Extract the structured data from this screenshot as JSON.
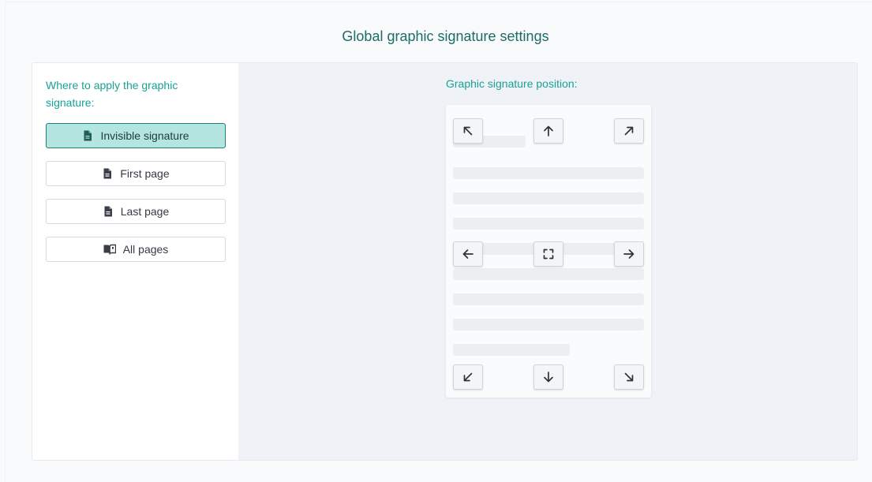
{
  "header": {
    "title": "Global graphic signature settings"
  },
  "apply": {
    "label": "Where to apply the graphic signature:",
    "options": [
      {
        "label": "Invisible signature",
        "icon": "file-icon",
        "selected": true
      },
      {
        "label": "First page",
        "icon": "file-icon",
        "selected": false
      },
      {
        "label": "Last page",
        "icon": "file-icon",
        "selected": false
      },
      {
        "label": "All pages",
        "icon": "book-open-icon",
        "selected": false
      }
    ]
  },
  "position": {
    "label": "Graphic signature position:",
    "buttons": [
      "top-left",
      "top-center",
      "top-right",
      "middle-left",
      "center",
      "middle-right",
      "bottom-left",
      "bottom-center",
      "bottom-right"
    ]
  },
  "colors": {
    "accent": "#1aa195",
    "title": "#1d6b66",
    "selected_bg": "#b4e5e0",
    "selected_border": "#1a7f78"
  }
}
